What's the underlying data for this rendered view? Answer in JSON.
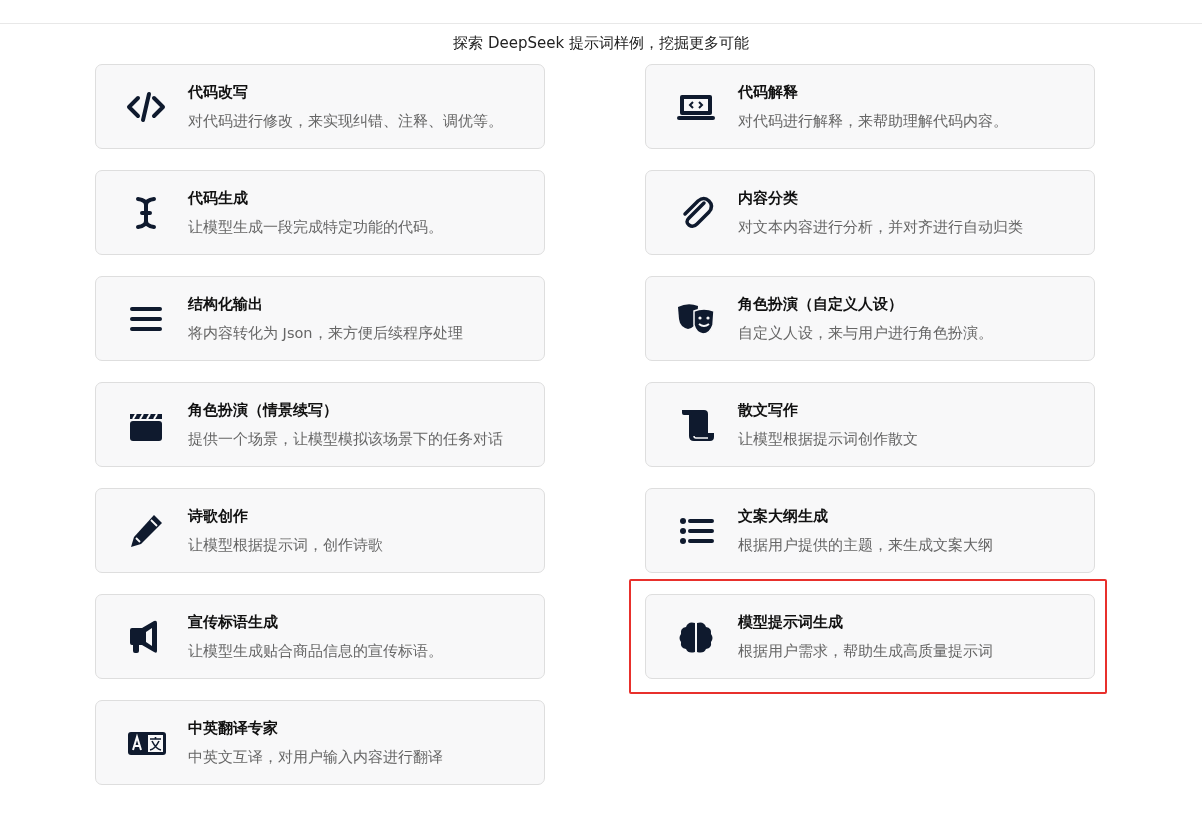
{
  "subtitle": "探索 DeepSeek 提示词样例，挖掘更多可能",
  "cards": [
    {
      "kind": "code",
      "title": "代码改写",
      "description": "对代码进行修改，来实现纠错、注释、调优等。",
      "highlighted": false
    },
    {
      "kind": "laptop",
      "title": "代码解释",
      "description": "对代码进行解释，来帮助理解代码内容。",
      "highlighted": false
    },
    {
      "kind": "cursor",
      "title": "代码生成",
      "description": "让模型生成一段完成特定功能的代码。",
      "highlighted": false
    },
    {
      "kind": "paperclip",
      "title": "内容分类",
      "description": "对文本内容进行分析，并对齐进行自动归类",
      "highlighted": false
    },
    {
      "kind": "bars",
      "title": "结构化输出",
      "description": "将内容转化为 Json，来方便后续程序处理",
      "highlighted": false
    },
    {
      "kind": "masks",
      "title": "角色扮演（自定义人设）",
      "description": "自定义人设，来与用户进行角色扮演。",
      "highlighted": false
    },
    {
      "kind": "clapper",
      "title": "角色扮演（情景续写）",
      "description": "提供一个场景，让模型模拟该场景下的任务对话",
      "highlighted": false
    },
    {
      "kind": "scroll",
      "title": "散文写作",
      "description": "让模型根据提示词创作散文",
      "highlighted": false
    },
    {
      "kind": "pencil",
      "title": "诗歌创作",
      "description": "让模型根据提示词，创作诗歌",
      "highlighted": false
    },
    {
      "kind": "list",
      "title": "文案大纲生成",
      "description": "根据用户提供的主题，来生成文案大纲",
      "highlighted": false
    },
    {
      "kind": "megaphone",
      "title": "宣传标语生成",
      "description": "让模型生成贴合商品信息的宣传标语。",
      "highlighted": false
    },
    {
      "kind": "brain",
      "title": "模型提示词生成",
      "description": "根据用户需求，帮助生成高质量提示词",
      "highlighted": true
    },
    {
      "kind": "translate",
      "title": "中英翻译专家",
      "description": "中英文互译，对用户输入内容进行翻译",
      "highlighted": false
    }
  ]
}
